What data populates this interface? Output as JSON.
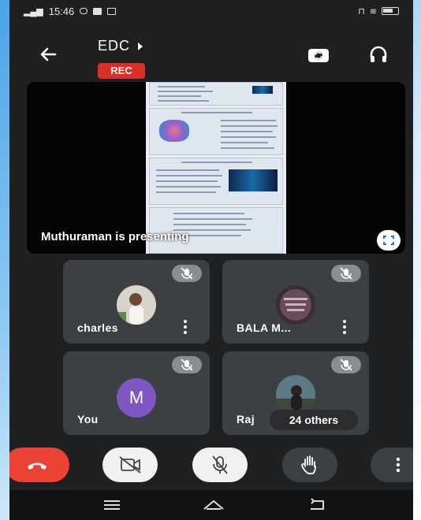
{
  "status_bar": {
    "time": "15:46",
    "carrier": "ᵀⁿ",
    "battery_label": ""
  },
  "header": {
    "title": "EDC",
    "recording_badge": "REC"
  },
  "presentation": {
    "presenter_text": "Muthuraman is presenting"
  },
  "participants": [
    {
      "name": "charles",
      "mic": "muted",
      "avatar": "photo"
    },
    {
      "name": "BALA M...",
      "mic": "muted",
      "avatar": "photo"
    },
    {
      "name": "You",
      "mic": "muted",
      "avatar_letter": "M",
      "avatar_color": "#7e57c2"
    },
    {
      "name": "Raj",
      "mic": "muted",
      "avatar": "photo",
      "overflow_label": "24 others"
    }
  ],
  "controls": {
    "end_call": "end-call-icon",
    "camera": "camera-off-icon",
    "microphone": "mic-off-icon",
    "raise_hand": "hand-icon",
    "more": "more-vert-icon"
  },
  "colors": {
    "recording": "#d93025",
    "end_call": "#ea4335",
    "tile_bg": "#3c4043",
    "self_avatar": "#7e57c2"
  }
}
